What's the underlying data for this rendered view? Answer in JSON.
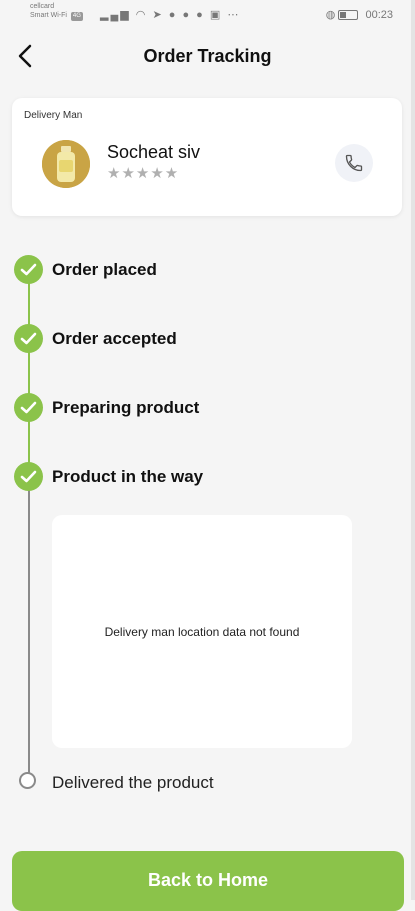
{
  "status_bar": {
    "carrier_line1": "cellcard",
    "carrier_line2": "Smart Wi-Fi",
    "network_badge": "4G",
    "icons": [
      "signal-icon",
      "signal-icon",
      "wifi-icon",
      "telegram-icon",
      "messenger-icon",
      "facebook-icon",
      "facebook-icon",
      "gallery-icon",
      "more-icon"
    ],
    "time": "00:23"
  },
  "header": {
    "title": "Order Tracking",
    "back_icon": "chevron-left-icon"
  },
  "delivery_card": {
    "label": "Delivery Man",
    "name": "Socheat siv",
    "rating_display": "★★★★★",
    "rating_value": 0,
    "rating_max": 5,
    "call_icon": "phone-icon"
  },
  "timeline": {
    "steps": [
      {
        "label": "Order placed",
        "completed": true
      },
      {
        "label": "Order accepted",
        "completed": true
      },
      {
        "label": "Preparing product",
        "completed": true
      },
      {
        "label": "Product in the way",
        "completed": true
      },
      {
        "label": "Delivered the product",
        "completed": false
      }
    ]
  },
  "map": {
    "message": "Delivery man location data not found"
  },
  "footer": {
    "button_label": "Back to Home"
  },
  "colors": {
    "accent": "#8bc34a",
    "pending": "#8a8a8a",
    "background": "#f5f5f5",
    "card": "#ffffff"
  }
}
